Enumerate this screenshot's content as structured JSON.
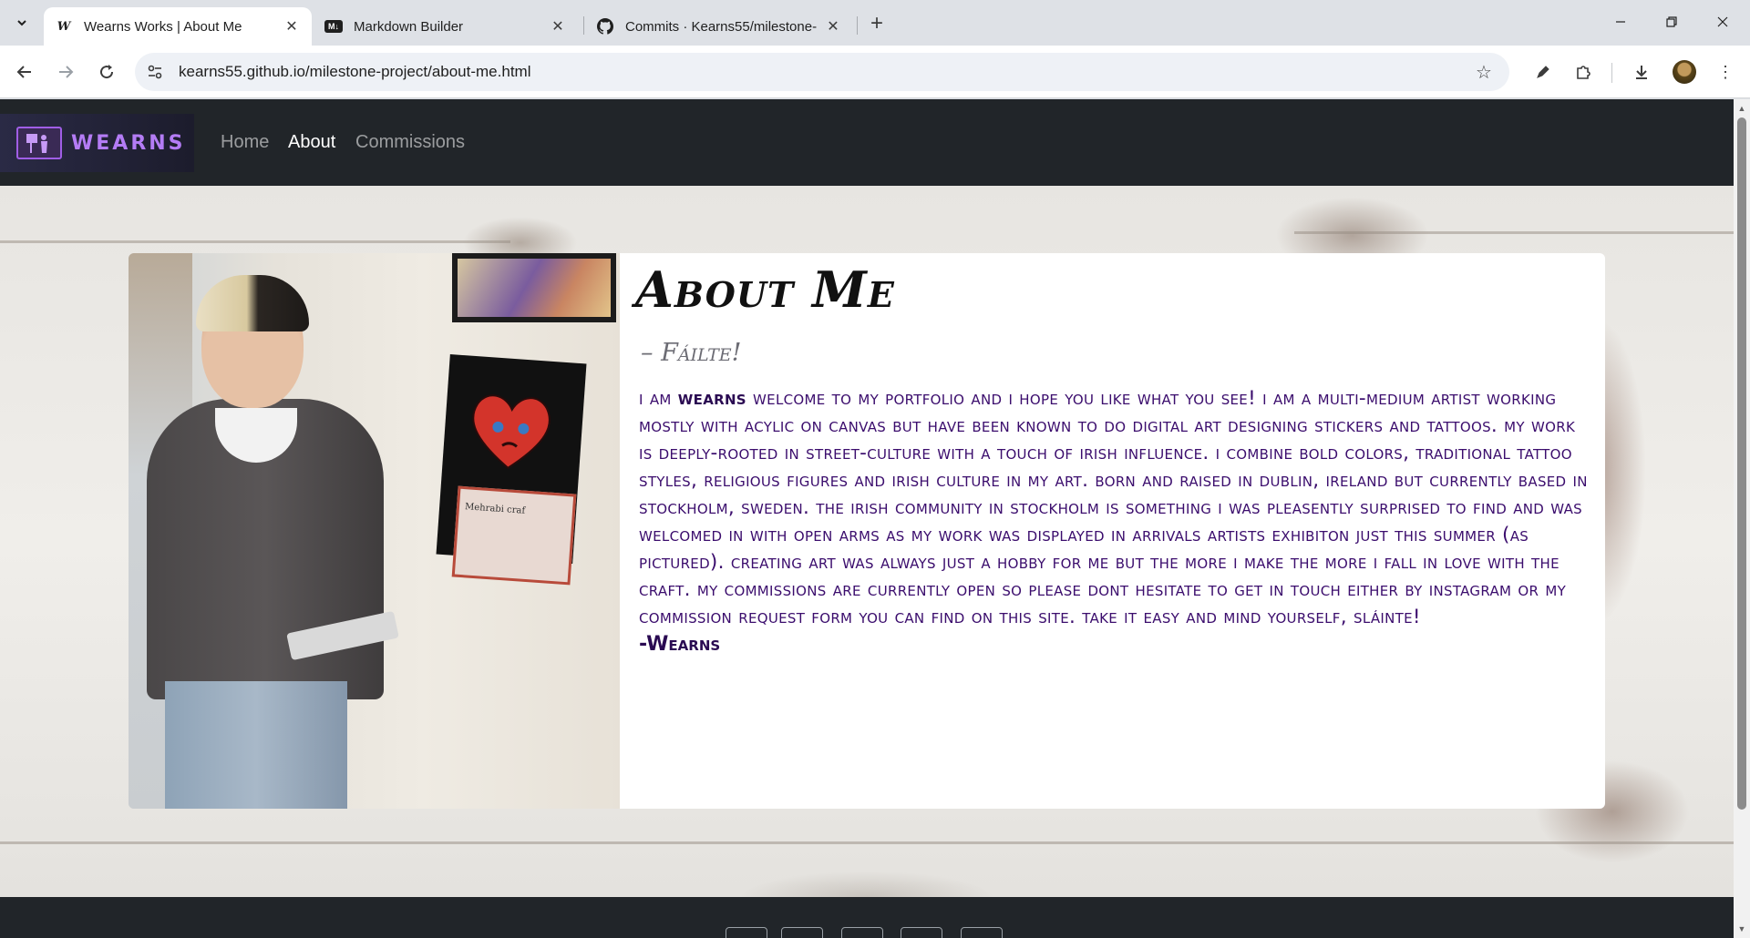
{
  "browser": {
    "tabs": [
      {
        "title": "Wearns Works | About Me",
        "favicon": "W",
        "active": true
      },
      {
        "title": "Markdown Builder",
        "favicon": "M↓",
        "active": false
      },
      {
        "title": "Commits · Kearns55/milestone-",
        "favicon": "github-icon",
        "active": false
      }
    ],
    "url": "kearns55.github.io/milestone-project/about-me.html"
  },
  "site": {
    "brand": "WEARNS",
    "nav": [
      {
        "label": "Home",
        "active": false
      },
      {
        "label": "About",
        "active": true
      },
      {
        "label": "Commissions",
        "active": false
      }
    ],
    "about": {
      "title": "About Me",
      "subtitle": "– Fáilte!",
      "body_intro": "I am ",
      "body_name": "Wearns",
      "body_text": " welcome to my portfolio and I hope you like what you see! I am a multi-medium artist working mostly with acylic on canvas but have been known to do digital art designing stickers and tattoos. My work is deeply-rooted in street-culture with a touch of Irish influence. I combine bold colors, traditional tattoo styles, religious figures and Irish culture in my art. Born and raised in Dublin, Ireland but currently based in Stockholm, Sweden. The Irish community in Stockholm is something I was pleasently surprised to find and was welcomed in with open arms as my work was displayed in Arrivals Artists Exhibiton just this summer (as pictured). Creating art was always just a hobby for me but the more I make the more I fall in love with the craft. My commissions are currently open so please dont hesitate to get in touch either by Instagram or my commission request form you can find on this site. Take it easy and mind yourself, Sláinte!",
      "signature": "-Wearns",
      "photo_caption_text": "Mehrabi craf"
    }
  },
  "colors": {
    "nav_bg": "#212529",
    "brand_purple": "#b47cf5",
    "body_text": "#3b0d6d"
  }
}
